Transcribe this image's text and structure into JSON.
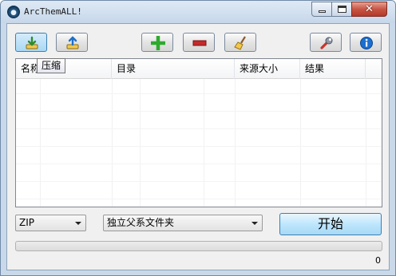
{
  "window": {
    "title": "ArcThemALL!",
    "minimize_glyph": "",
    "close_glyph": "✕"
  },
  "toolbar": {
    "tooltip": "压缩",
    "buttons": [
      {
        "name": "compress-button",
        "icon": "download-arrow-icon"
      },
      {
        "name": "extract-button",
        "icon": "upload-arrow-icon"
      },
      {
        "name": "add-button",
        "icon": "plus-icon"
      },
      {
        "name": "remove-button",
        "icon": "minus-icon"
      },
      {
        "name": "clear-button",
        "icon": "broom-icon"
      },
      {
        "name": "settings-button",
        "icon": "wrench-icon"
      },
      {
        "name": "about-button",
        "icon": "info-icon"
      }
    ]
  },
  "list": {
    "columns": [
      "名称",
      "目录",
      "来源大小",
      "结果"
    ],
    "rows": []
  },
  "options": {
    "format": "ZIP",
    "destination": "独立父系文件夹"
  },
  "start_label": "开始",
  "progress": {
    "value": 0
  },
  "file_count": "0",
  "colors": {
    "plus": "#2eaa2e",
    "minus": "#c42a2a",
    "info": "#1b6fd0",
    "progress_track": "#e4e4e4"
  }
}
